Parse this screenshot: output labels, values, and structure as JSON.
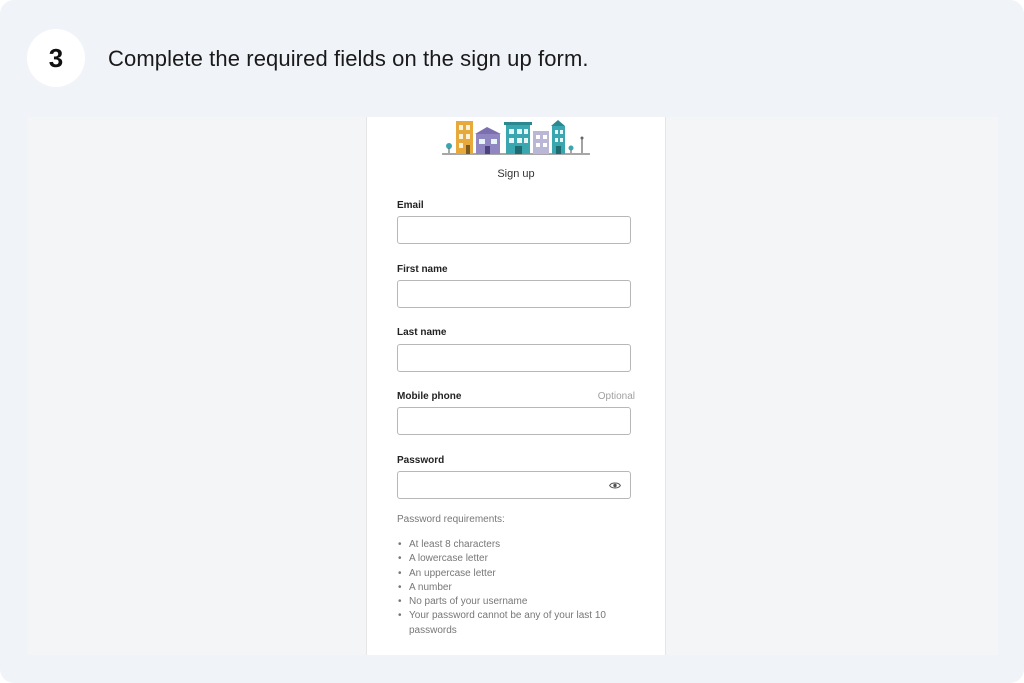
{
  "step": {
    "number": "3",
    "text": "Complete the required fields on the sign up form."
  },
  "form": {
    "title": "Sign up",
    "logo_icon": "town-buildings-illustration",
    "fields": {
      "email": {
        "label": "Email",
        "value": ""
      },
      "first_name": {
        "label": "First name",
        "value": ""
      },
      "last_name": {
        "label": "Last name",
        "value": ""
      },
      "mobile_phone": {
        "label": "Mobile phone",
        "optional": "Optional",
        "value": ""
      },
      "password": {
        "label": "Password",
        "value": "",
        "toggle_icon": "eye-icon"
      }
    },
    "requirements": {
      "title": "Password requirements:",
      "items": [
        "At least 8 characters",
        "A lowercase letter",
        "An uppercase letter",
        "A number",
        "No parts of your username",
        "Your password cannot be any of your last 10 passwords"
      ]
    }
  },
  "colors": {
    "card_background": "#f0f3f8",
    "input_border": "#b7b7b7",
    "muted_text": "#777777"
  }
}
